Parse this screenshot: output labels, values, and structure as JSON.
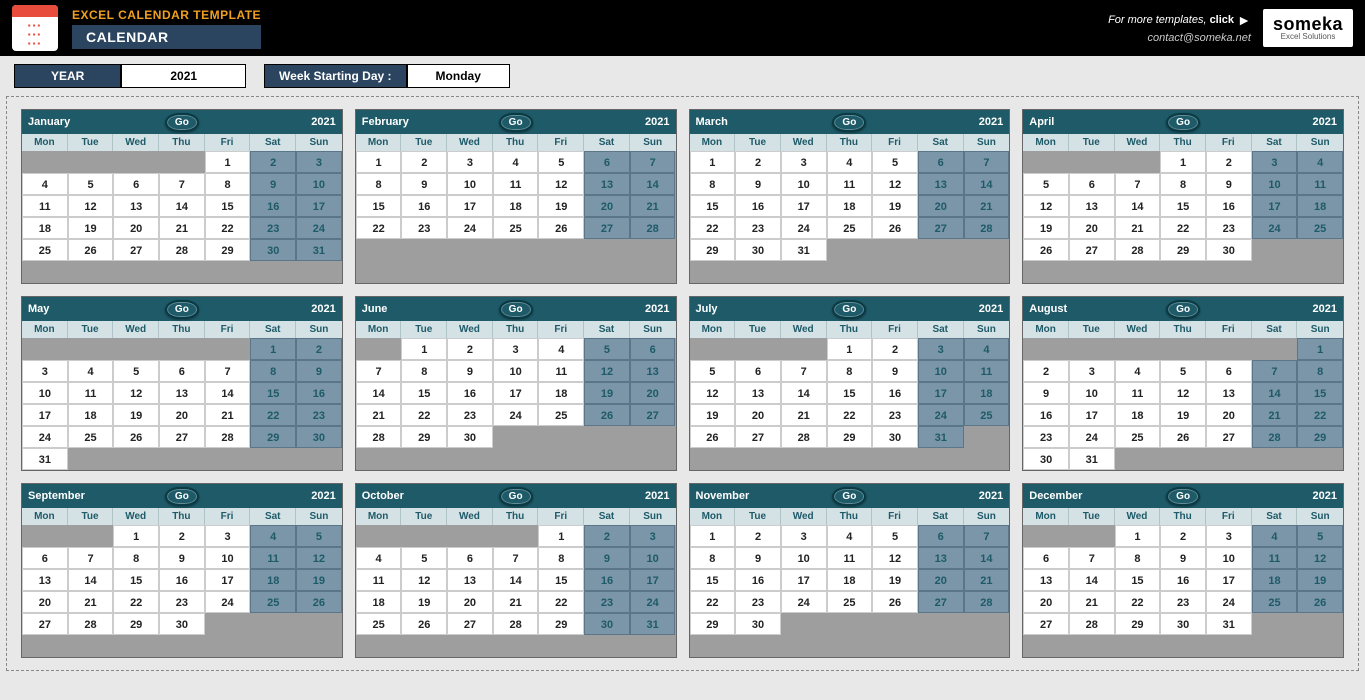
{
  "header": {
    "title1": "EXCEL CALENDAR TEMPLATE",
    "title2": "CALENDAR",
    "more_templates_prefix": "For more templates, ",
    "more_templates_action": "click",
    "contact": "contact@someka.net",
    "logo_big": "someka",
    "logo_small": "Excel Solutions"
  },
  "controls": {
    "year_label": "YEAR",
    "year_value": "2021",
    "weekstart_label": "Week Starting Day :",
    "weekstart_value": "Monday"
  },
  "dow": [
    "Mon",
    "Tue",
    "Wed",
    "Thu",
    "Fri",
    "Sat",
    "Sun"
  ],
  "go_label": "Go",
  "months": [
    {
      "name": "January",
      "year": "2021",
      "start": 4,
      "days": 31
    },
    {
      "name": "February",
      "year": "2021",
      "start": 0,
      "days": 28
    },
    {
      "name": "March",
      "year": "2021",
      "start": 0,
      "days": 31
    },
    {
      "name": "April",
      "year": "2021",
      "start": 3,
      "days": 30
    },
    {
      "name": "May",
      "year": "2021",
      "start": 5,
      "days": 31
    },
    {
      "name": "June",
      "year": "2021",
      "start": 1,
      "days": 30
    },
    {
      "name": "July",
      "year": "2021",
      "start": 3,
      "days": 31
    },
    {
      "name": "August",
      "year": "2021",
      "start": 6,
      "days": 31
    },
    {
      "name": "September",
      "year": "2021",
      "start": 2,
      "days": 30
    },
    {
      "name": "October",
      "year": "2021",
      "start": 4,
      "days": 31
    },
    {
      "name": "November",
      "year": "2021",
      "start": 0,
      "days": 30
    },
    {
      "name": "December",
      "year": "2021",
      "start": 2,
      "days": 31
    }
  ]
}
